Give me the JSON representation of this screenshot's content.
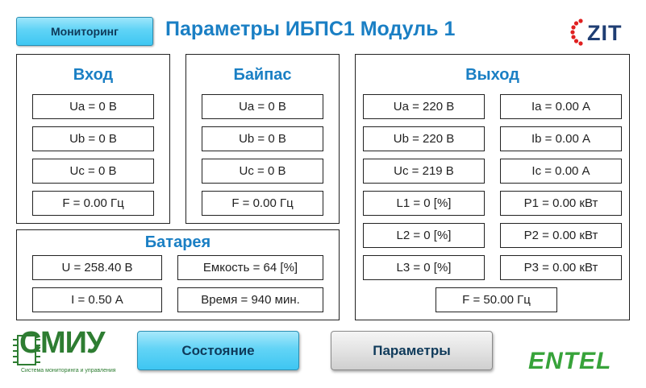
{
  "header": {
    "monitoring_button": "Мониторинг",
    "title": "Параметры ИБПС1 Модуль 1",
    "logo_zit": "ZIT"
  },
  "input": {
    "title": "Вход",
    "values": [
      "Ua = 0 В",
      "Ub = 0 В",
      "Uc = 0 В",
      "F = 0.00 Гц"
    ]
  },
  "bypass": {
    "title": "Байпас",
    "values": [
      "Ua = 0 В",
      "Ub = 0 В",
      "Uc = 0 В",
      "F = 0.00 Гц"
    ]
  },
  "battery": {
    "title": "Батарея",
    "voltage": "U = 258.40 В",
    "capacity": "Емкость = 64 [%]",
    "current": "I = 0.50 А",
    "time": "Время = 940 мин."
  },
  "output": {
    "title": "Выход",
    "left": [
      "Ua = 220 В",
      "Ub = 220 В",
      "Uc = 219 В",
      "L1 = 0 [%]",
      "L2 = 0 [%]",
      "L3 = 0 [%]"
    ],
    "right": [
      "Ia = 0.00 А",
      "Ib = 0.00 А",
      "Ic = 0.00 А",
      "P1 = 0.00 кВт",
      "P2 = 0.00 кВт",
      "P3 = 0.00 кВт"
    ],
    "frequency": "F = 50.00 Гц"
  },
  "footer": {
    "state_button": "Состояние",
    "params_button": "Параметры",
    "logo_smiu": "СМИУ",
    "logo_smiu_sub": "Система мониторинга и управления",
    "logo_entel": "ENTEL"
  },
  "colors": {
    "title_blue": "#1a7fc4",
    "button_cyan": "#3fc7f2",
    "logo_green": "#2e7d32",
    "entel_green": "#37a33a",
    "zit_red": "#e02020",
    "zit_navy": "#1f3e73"
  }
}
